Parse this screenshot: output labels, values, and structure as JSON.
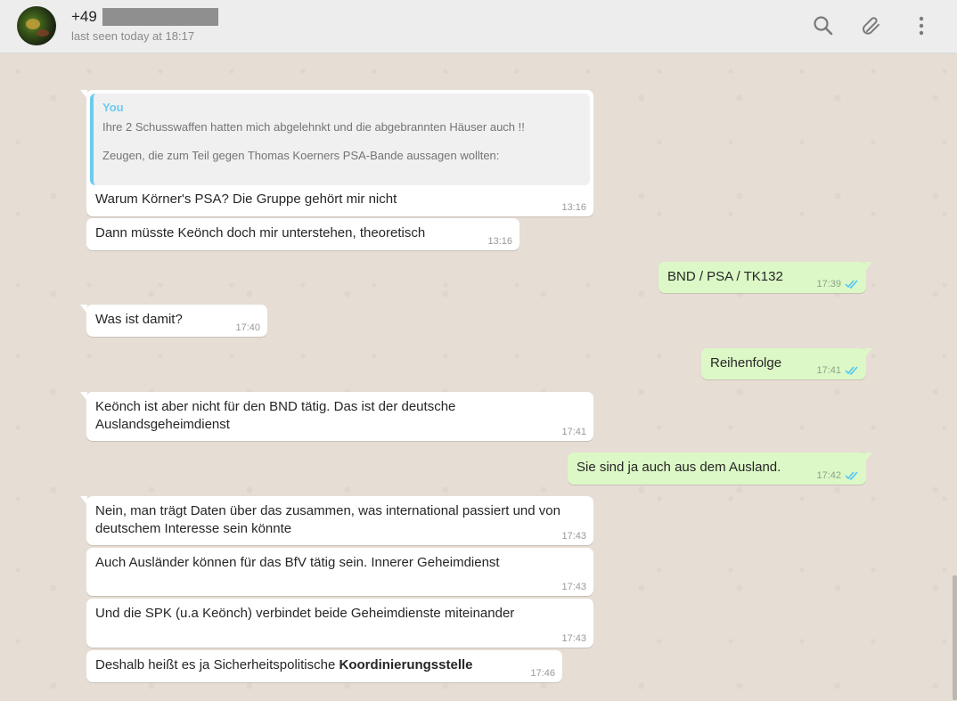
{
  "header": {
    "contact_name": "+49",
    "last_seen": "last seen today at 18:17",
    "icons": [
      "search-icon",
      "attach-icon",
      "menu-icon"
    ]
  },
  "colors": {
    "incoming_bubble": "#ffffff",
    "outgoing_bubble": "#dcf8c6",
    "quote_accent": "#6bcbef",
    "read_ticks": "#4fc3f7",
    "chat_background": "#e6ddd4"
  },
  "messages": [
    {
      "direction": "in",
      "quoted": {
        "author": "You",
        "line1": "Ihre 2 Schusswaffen hatten mich abgelehnkt und die abgebrannten Häuser auch !!",
        "line2": "Zeugen, die zum Teil gegen Thomas Koerners PSA-Bande aussagen wollten:"
      },
      "text": "Warum Körner's PSA? Die Gruppe gehört mir nicht",
      "time": "13:16"
    },
    {
      "direction": "in",
      "text": "Dann müsste Keönch doch mir unterstehen, theoretisch",
      "time": "13:16"
    },
    {
      "direction": "out",
      "text": "BND / PSA / TK132",
      "time": "17:39"
    },
    {
      "direction": "in",
      "text": "Was ist damit?",
      "time": "17:40"
    },
    {
      "direction": "out",
      "text": "Reihenfolge",
      "time": "17:41"
    },
    {
      "direction": "in",
      "text_line1": "Keönch ist aber nicht für den BND tätig. Das ist der deutsche",
      "text_line2": "Auslandsgeheimdienst",
      "time": "17:41"
    },
    {
      "direction": "out",
      "text": "Sie sind ja auch aus dem Ausland.",
      "time": "17:42"
    },
    {
      "direction": "in",
      "text_line1": "Nein, man trägt Daten über das zusammen, was international passiert und von",
      "text_line2": "deutschem Interesse sein könnte",
      "time": "17:43"
    },
    {
      "direction": "in",
      "text": "Auch Ausländer können für das BfV tätig sein. Innerer Geheimdienst",
      "time": "17:43"
    },
    {
      "direction": "in",
      "text": "Und die SPK (u.a Keönch) verbindet beide Geheimdienste miteinander",
      "time": "17:43"
    },
    {
      "direction": "in",
      "text_plain": "Deshalb heißt es ja Sicherheitspolitische ",
      "text_bold": "Koordinierungsstelle",
      "time": "17:46"
    }
  ]
}
